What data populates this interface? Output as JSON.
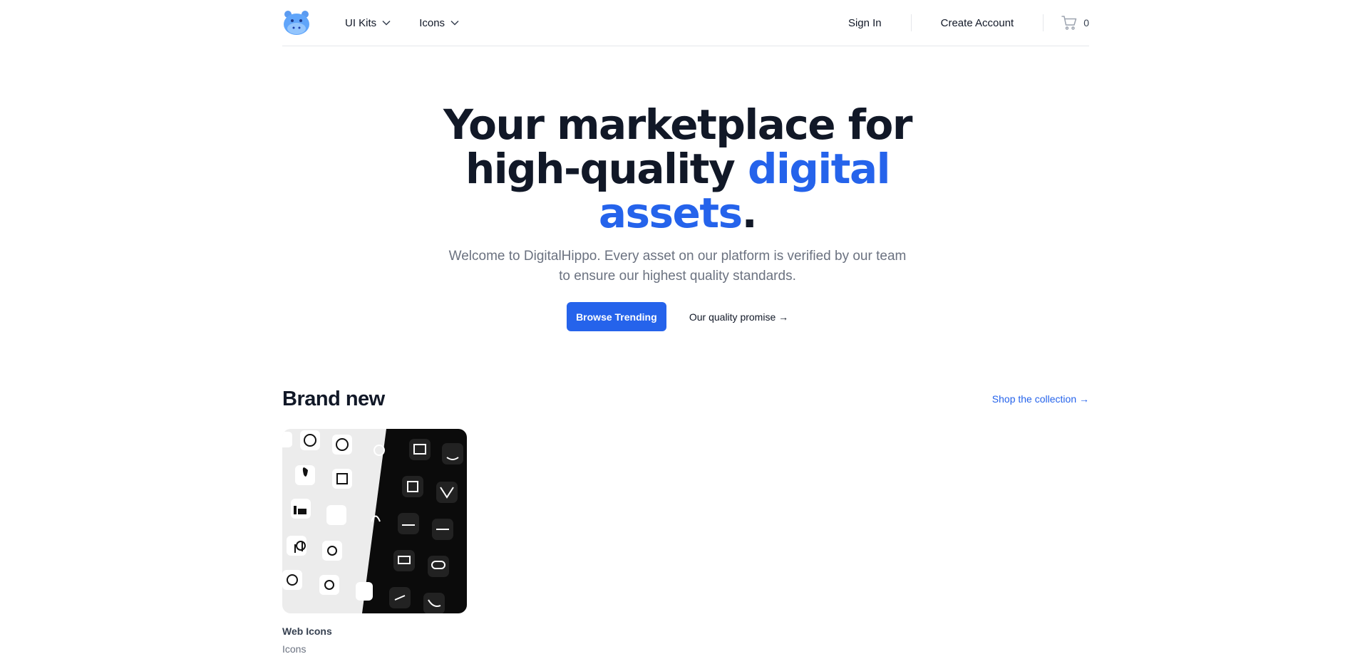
{
  "navbar": {
    "logo": "hippo-logo",
    "menus": [
      {
        "label": "UI Kits"
      },
      {
        "label": "Icons"
      }
    ],
    "sign_in": "Sign In",
    "create_account": "Create Account",
    "cart_count": "0"
  },
  "hero": {
    "title_part1": "Your marketplace for high-quality ",
    "title_accent": "digital assets",
    "title_end": ".",
    "subtitle": "Welcome to DigitalHippo. Every asset on our platform is verified by our team to ensure our highest quality standards.",
    "primary_button": "Browse Trending",
    "secondary_button": "Our quality promise →"
  },
  "brand_new": {
    "title": "Brand new",
    "link": "Shop the collection →",
    "products": [
      {
        "name": "Web Icons",
        "category": "Icons"
      }
    ]
  },
  "colors": {
    "accent": "#2563eb",
    "text": "#111827",
    "muted": "#6b7280"
  }
}
